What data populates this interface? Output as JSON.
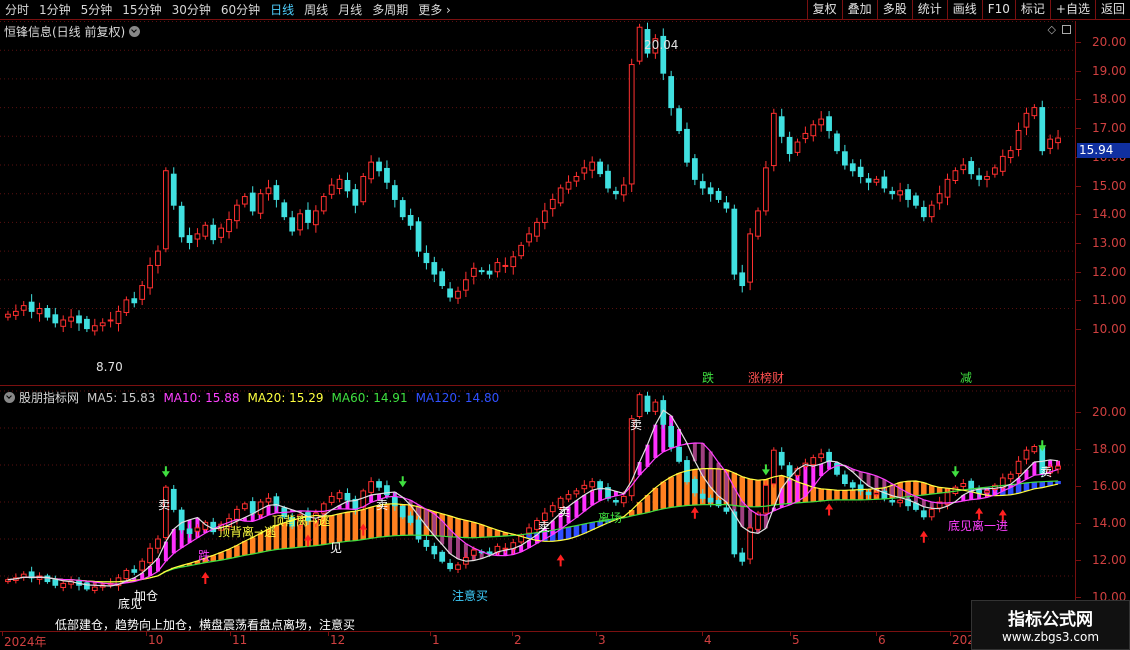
{
  "toolbar": {
    "periods": [
      "分时",
      "1分钟",
      "5分钟",
      "15分钟",
      "30分钟",
      "60分钟",
      "日线",
      "周线",
      "月线",
      "多周期",
      "更多"
    ],
    "active_period": "日线",
    "more_icon": "chevron-right-icon",
    "buttons": [
      "复权",
      "叠加",
      "多股",
      "统计",
      "画线",
      "F10",
      "标记",
      "+自选",
      "返回"
    ]
  },
  "main_panel": {
    "title": "恒锋信息(日线 前复权)",
    "high_label": "20.04",
    "low_label": "8.70",
    "event_tags": [
      {
        "text": "跌",
        "color": "#40e040"
      },
      {
        "text": "涨榜财",
        "color": "#ff4040"
      },
      {
        "text": "减",
        "color": "#40e040"
      }
    ],
    "last_price": "15.94",
    "corner_icons": [
      "diamond-icon",
      "square-icon"
    ]
  },
  "price_axis_main": [
    "20.00",
    "19.00",
    "18.00",
    "17.00",
    "16.00",
    "15.00",
    "14.00",
    "13.00",
    "12.00",
    "11.00",
    "10.00"
  ],
  "price_axis_ind": [
    "20.00",
    "18.00",
    "16.00",
    "14.00",
    "12.00",
    "10.00"
  ],
  "indicator_panel": {
    "title": "股朋指标网",
    "ma": [
      {
        "label": "MA5: 15.83",
        "color": "#c8c8c8"
      },
      {
        "label": "MA10: 15.88",
        "color": "#ff40ff"
      },
      {
        "label": "MA20: 15.29",
        "color": "#ffff40"
      },
      {
        "label": "MA60: 14.91",
        "color": "#40e040"
      },
      {
        "label": "MA120: 14.80",
        "color": "#3050ff"
      }
    ],
    "annotations": [
      "卖",
      "卖",
      "卖",
      "卖",
      "卖",
      "卖",
      "顶背离→逃",
      "顶背离→逃",
      "离场",
      "底见",
      "注意买",
      "见",
      "跌",
      "加仓",
      "底见离一进"
    ],
    "bottom_text": "低部建仓，趋势向上加仓，横盘震荡看盘点离场，注意买"
  },
  "time_axis": [
    "2024年",
    "10",
    "11",
    "12",
    "1",
    "2",
    "3",
    "4",
    "5",
    "6",
    "202"
  ],
  "watermark": {
    "title": "指标公式网",
    "url": "www.zbgs3.com"
  },
  "chart_data": {
    "type": "candlestick",
    "title": "恒锋信息(日线 前复权)",
    "ylim": [
      9.6,
      20.3
    ],
    "high": 20.04,
    "low": 8.7,
    "last": 15.94,
    "closes": [
      9.8,
      9.9,
      10.1,
      9.9,
      10.0,
      9.7,
      9.5,
      9.6,
      9.7,
      9.5,
      9.3,
      9.4,
      9.5,
      9.6,
      9.9,
      10.3,
      10.2,
      10.8,
      11.5,
      12.0,
      14.8,
      13.6,
      12.5,
      12.3,
      12.6,
      12.9,
      12.4,
      12.8,
      13.1,
      13.6,
      13.9,
      13.4,
      14.0,
      14.2,
      13.8,
      13.2,
      12.7,
      13.3,
      13.0,
      13.4,
      13.9,
      14.3,
      14.5,
      14.1,
      13.6,
      14.6,
      15.1,
      14.8,
      14.4,
      13.8,
      13.2,
      12.9,
      12.0,
      11.6,
      11.2,
      10.8,
      10.4,
      10.6,
      11.0,
      11.4,
      11.3,
      11.2,
      11.6,
      11.5,
      11.8,
      12.2,
      12.6,
      13.0,
      13.4,
      13.8,
      14.2,
      14.4,
      14.6,
      14.9,
      15.1,
      14.7,
      14.2,
      14.0,
      14.3,
      18.5,
      19.8,
      18.9,
      19.4,
      18.2,
      17.0,
      16.2,
      15.1,
      14.5,
      14.2,
      14.0,
      13.8,
      13.5,
      11.2,
      10.8,
      12.6,
      13.4,
      14.9,
      16.8,
      16.0,
      15.4,
      15.8,
      16.1,
      16.4,
      16.6,
      16.2,
      15.5,
      15.0,
      14.8,
      14.6,
      14.4,
      14.5,
      14.2,
      14.0,
      14.1,
      13.8,
      13.6,
      13.2,
      13.6,
      14.0,
      14.5,
      14.8,
      15.0,
      14.7,
      14.5,
      14.6,
      14.9,
      15.3,
      15.5,
      16.2,
      16.8,
      17.0,
      15.5,
      15.9,
      15.94
    ]
  }
}
